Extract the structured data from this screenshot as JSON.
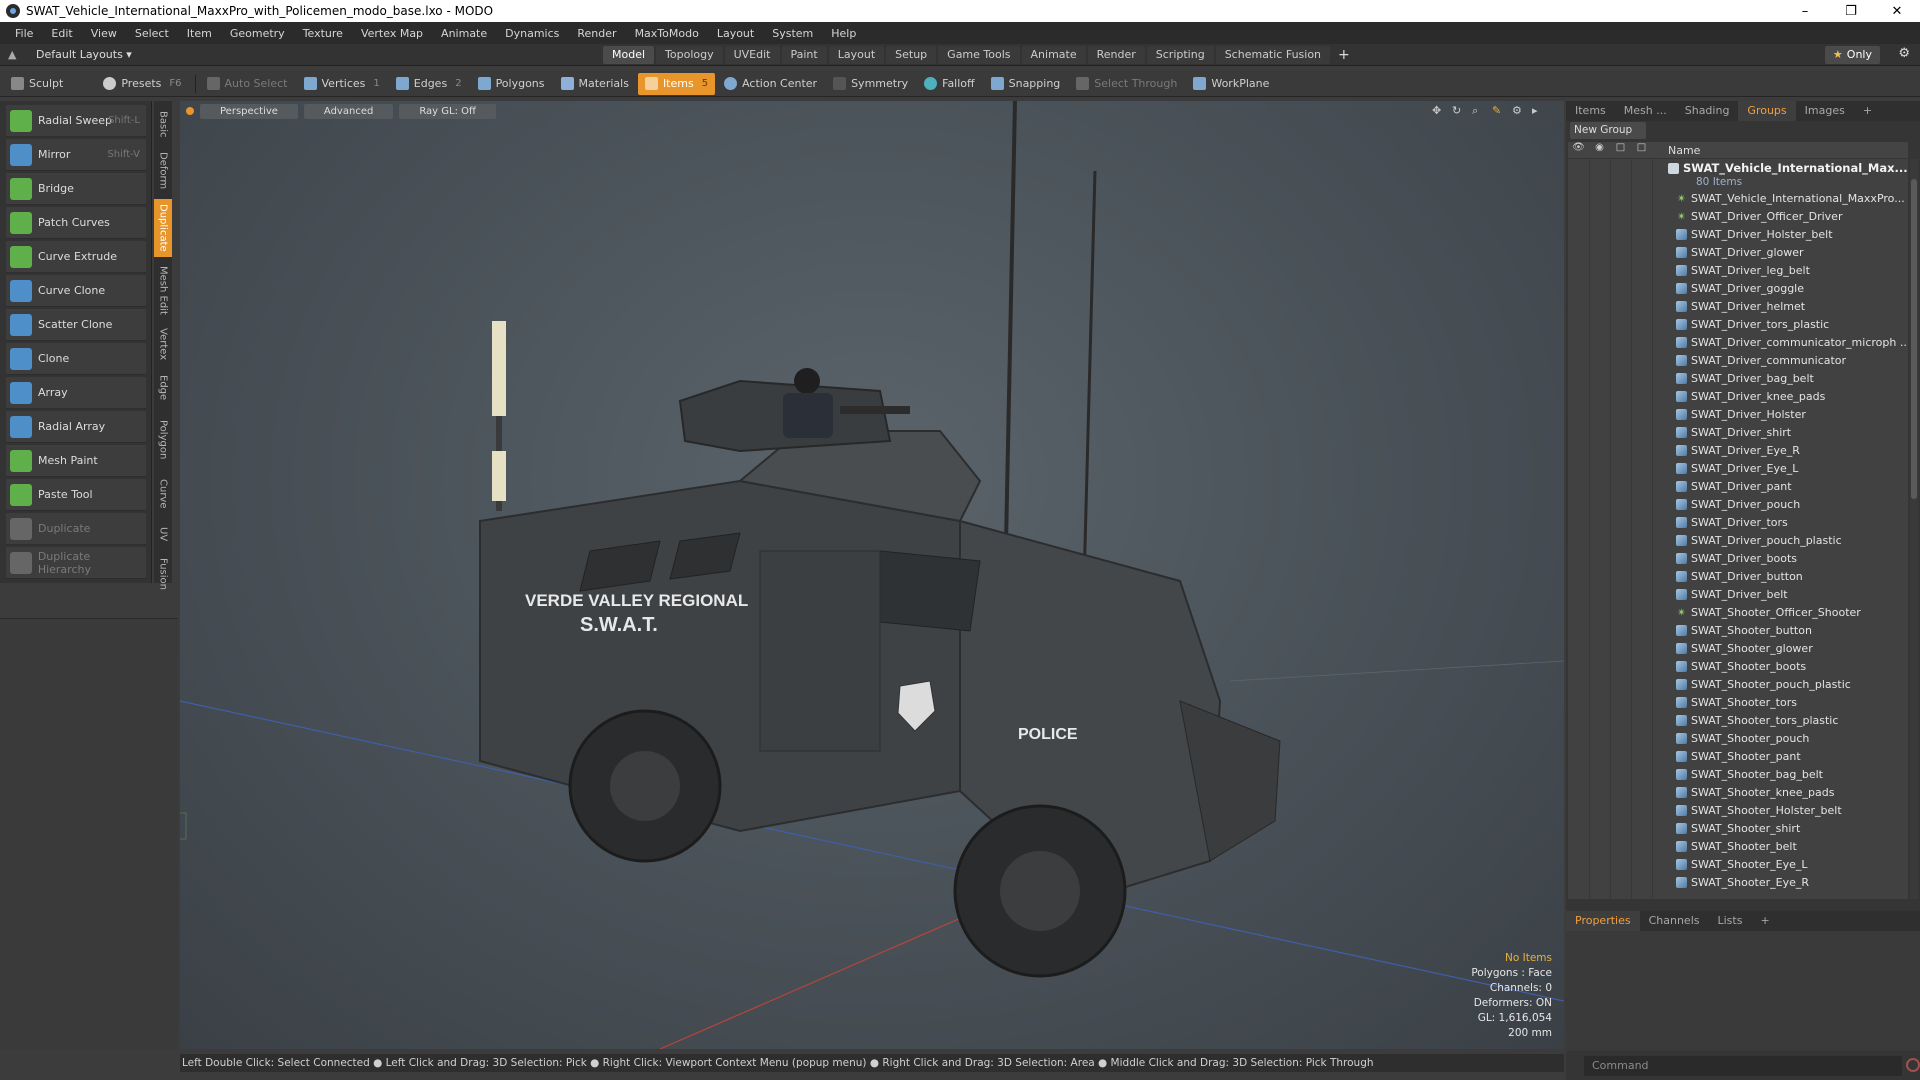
{
  "window": {
    "title": "SWAT_Vehicle_International_MaxxPro_with_Policemen_modo_base.lxo - MODO",
    "controls": [
      "–",
      "❐",
      "✕"
    ]
  },
  "menu": [
    "File",
    "Edit",
    "View",
    "Select",
    "Item",
    "Geometry",
    "Texture",
    "Vertex Map",
    "Animate",
    "Dynamics",
    "Render",
    "MaxToModo",
    "Layout",
    "System",
    "Help"
  ],
  "layout_bar": {
    "layouts_label": "Default Layouts ▾",
    "tabs": [
      "Model",
      "Topology",
      "UVEdit",
      "Paint",
      "Layout",
      "Setup",
      "Game Tools",
      "Animate",
      "Render",
      "Scripting",
      "Schematic Fusion"
    ],
    "active_tab": "Model",
    "plus": "+",
    "only_label": "Only",
    "star": "★"
  },
  "toolbar": {
    "sculpt": "Sculpt",
    "presets": "Presets",
    "presets_key": "F6",
    "auto_select": "Auto Select",
    "vertices": "Vertices",
    "vertices_count": "1",
    "edges": "Edges",
    "edges_count": "2",
    "polygons": "Polygons",
    "materials": "Materials",
    "items": "Items",
    "items_count": "5",
    "action_center": "Action Center",
    "symmetry": "Symmetry",
    "falloff": "Falloff",
    "snapping": "Snapping",
    "select_through": "Select Through",
    "workplane": "WorkPlane"
  },
  "tools": [
    {
      "label": "Radial Sweep",
      "key": "Shift-L",
      "color": "#5fb04a",
      "disabled": false
    },
    {
      "label": "Mirror",
      "key": "Shift-V",
      "color": "#4f8fc9",
      "disabled": false
    },
    {
      "label": "Bridge",
      "key": "",
      "color": "#5fb04a",
      "disabled": false
    },
    {
      "label": "Patch Curves",
      "key": "",
      "color": "#5fb04a",
      "disabled": false
    },
    {
      "label": "Curve Extrude",
      "key": "",
      "color": "#5fb04a",
      "disabled": false
    },
    {
      "label": "Curve Clone",
      "key": "",
      "color": "#4f8fc9",
      "disabled": false
    },
    {
      "label": "Scatter Clone",
      "key": "",
      "color": "#4f8fc9",
      "disabled": false
    },
    {
      "label": "Clone",
      "key": "",
      "color": "#4f8fc9",
      "disabled": false
    },
    {
      "label": "Array",
      "key": "",
      "color": "#4f8fc9",
      "disabled": false
    },
    {
      "label": "Radial Array",
      "key": "",
      "color": "#4f8fc9",
      "disabled": false
    },
    {
      "label": "Mesh Paint",
      "key": "",
      "color": "#5fb04a",
      "disabled": false
    },
    {
      "label": "Paste Tool",
      "key": "",
      "color": "#5fb04a",
      "disabled": false
    },
    {
      "label": "Duplicate",
      "key": "",
      "color": "#666666",
      "disabled": true
    },
    {
      "label": "Duplicate Hierarchy",
      "key": "",
      "color": "#666666",
      "disabled": true
    }
  ],
  "vertical_tabs": [
    "Basic",
    "Deform",
    "Duplicate",
    "Mesh Edit",
    "Vertex",
    "Edge",
    "Polygon",
    "Curve",
    "UV",
    "Fusion"
  ],
  "active_vertical_tab": "Duplicate",
  "viewport": {
    "buttons": [
      "Perspective",
      "Advanced",
      "Ray GL: Off"
    ],
    "decal_line1": "VERDE VALLEY REGIONAL",
    "decal_line2": "S.W.A.T.",
    "decal_police": "POLICE",
    "info": {
      "selection": "No Items",
      "polygons": "Polygons : Face",
      "channels": "Channels: 0",
      "deformers": "Deformers: ON",
      "gl": "GL: 1,616,054",
      "scale": "200 mm"
    }
  },
  "status_bar": "Left Double Click: Select Connected ● Left Click and Drag: 3D Selection: Pick ● Right Click: Viewport Context Menu (popup menu) ● Right Click and Drag: 3D Selection: Area ● Middle Click and Drag: 3D Selection: Pick Through",
  "right_panel": {
    "tabs": [
      "Items",
      "Mesh ...",
      "Shading",
      "Groups",
      "Images",
      "+"
    ],
    "active_tab": "Groups",
    "new_group": "New Group",
    "tree_header": "Name",
    "group_name": "SWAT_Vehicle_International_Max...",
    "group_count": "80 Items",
    "items": [
      {
        "name": "SWAT_Vehicle_International_MaxxPro...",
        "kind": "locator"
      },
      {
        "name": "SWAT_Driver_Officer_Driver",
        "kind": "locator"
      },
      {
        "name": "SWAT_Driver_Holster_belt",
        "kind": "mesh"
      },
      {
        "name": "SWAT_Driver_glower",
        "kind": "mesh"
      },
      {
        "name": "SWAT_Driver_leg_belt",
        "kind": "mesh"
      },
      {
        "name": "SWAT_Driver_goggle",
        "kind": "mesh"
      },
      {
        "name": "SWAT_Driver_helmet",
        "kind": "mesh"
      },
      {
        "name": "SWAT_Driver_tors_plastic",
        "kind": "mesh"
      },
      {
        "name": "SWAT_Driver_communicator_microph ...",
        "kind": "mesh"
      },
      {
        "name": "SWAT_Driver_communicator",
        "kind": "mesh"
      },
      {
        "name": "SWAT_Driver_bag_belt",
        "kind": "mesh"
      },
      {
        "name": "SWAT_Driver_knee_pads",
        "kind": "mesh"
      },
      {
        "name": "SWAT_Driver_Holster",
        "kind": "mesh"
      },
      {
        "name": "SWAT_Driver_shirt",
        "kind": "mesh"
      },
      {
        "name": "SWAT_Driver_Eye_R",
        "kind": "mesh"
      },
      {
        "name": "SWAT_Driver_Eye_L",
        "kind": "mesh"
      },
      {
        "name": "SWAT_Driver_pant",
        "kind": "mesh"
      },
      {
        "name": "SWAT_Driver_pouch",
        "kind": "mesh"
      },
      {
        "name": "SWAT_Driver_tors",
        "kind": "mesh"
      },
      {
        "name": "SWAT_Driver_pouch_plastic",
        "kind": "mesh"
      },
      {
        "name": "SWAT_Driver_boots",
        "kind": "mesh"
      },
      {
        "name": "SWAT_Driver_button",
        "kind": "mesh"
      },
      {
        "name": "SWAT_Driver_belt",
        "kind": "mesh"
      },
      {
        "name": "SWAT_Shooter_Officer_Shooter",
        "kind": "locator"
      },
      {
        "name": "SWAT_Shooter_button",
        "kind": "mesh"
      },
      {
        "name": "SWAT_Shooter_glower",
        "kind": "mesh"
      },
      {
        "name": "SWAT_Shooter_boots",
        "kind": "mesh"
      },
      {
        "name": "SWAT_Shooter_pouch_plastic",
        "kind": "mesh"
      },
      {
        "name": "SWAT_Shooter_tors",
        "kind": "mesh"
      },
      {
        "name": "SWAT_Shooter_tors_plastic",
        "kind": "mesh"
      },
      {
        "name": "SWAT_Shooter_pouch",
        "kind": "mesh"
      },
      {
        "name": "SWAT_Shooter_pant",
        "kind": "mesh"
      },
      {
        "name": "SWAT_Shooter_bag_belt",
        "kind": "mesh"
      },
      {
        "name": "SWAT_Shooter_knee_pads",
        "kind": "mesh"
      },
      {
        "name": "SWAT_Shooter_Holster_belt",
        "kind": "mesh"
      },
      {
        "name": "SWAT_Shooter_shirt",
        "kind": "mesh"
      },
      {
        "name": "SWAT_Shooter_belt",
        "kind": "mesh"
      },
      {
        "name": "SWAT_Shooter_Eye_L",
        "kind": "mesh"
      },
      {
        "name": "SWAT_Shooter_Eye_R",
        "kind": "mesh"
      }
    ],
    "props_tabs": [
      "Properties",
      "Channels",
      "Lists",
      "+"
    ],
    "active_props_tab": "Properties",
    "command_placeholder": "Command"
  },
  "colors": {
    "accent": "#e8962c",
    "panel_bg": "#353535",
    "viewport_bg": "#525a61"
  }
}
